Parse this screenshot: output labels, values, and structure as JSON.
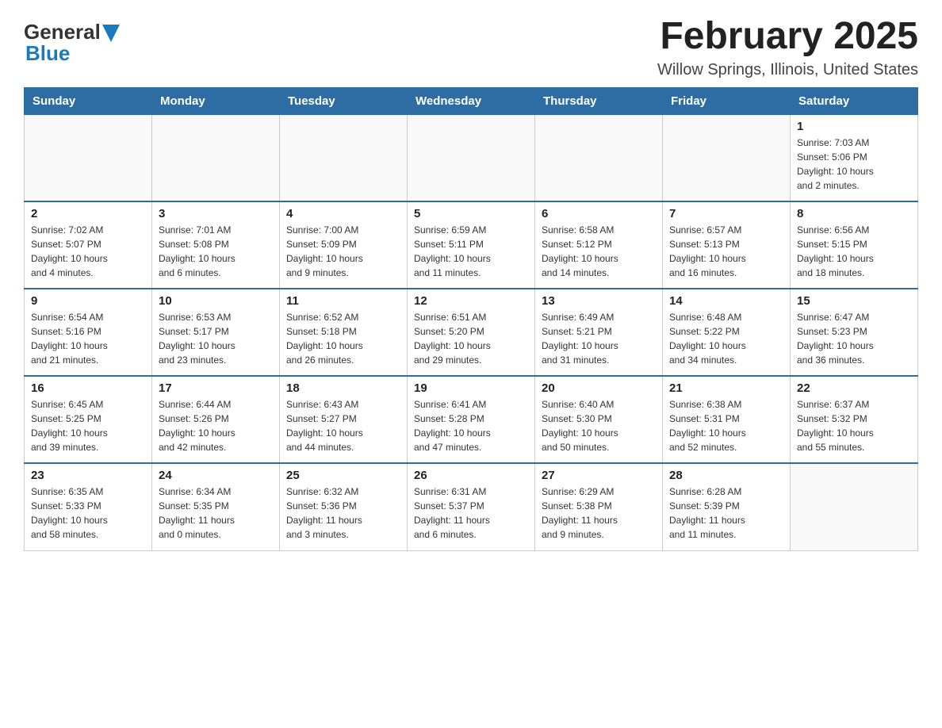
{
  "header": {
    "logo_general": "General",
    "logo_blue": "Blue",
    "month_title": "February 2025",
    "location": "Willow Springs, Illinois, United States"
  },
  "days_of_week": [
    "Sunday",
    "Monday",
    "Tuesday",
    "Wednesday",
    "Thursday",
    "Friday",
    "Saturday"
  ],
  "weeks": [
    [
      {
        "day": "",
        "info": ""
      },
      {
        "day": "",
        "info": ""
      },
      {
        "day": "",
        "info": ""
      },
      {
        "day": "",
        "info": ""
      },
      {
        "day": "",
        "info": ""
      },
      {
        "day": "",
        "info": ""
      },
      {
        "day": "1",
        "info": "Sunrise: 7:03 AM\nSunset: 5:06 PM\nDaylight: 10 hours\nand 2 minutes."
      }
    ],
    [
      {
        "day": "2",
        "info": "Sunrise: 7:02 AM\nSunset: 5:07 PM\nDaylight: 10 hours\nand 4 minutes."
      },
      {
        "day": "3",
        "info": "Sunrise: 7:01 AM\nSunset: 5:08 PM\nDaylight: 10 hours\nand 6 minutes."
      },
      {
        "day": "4",
        "info": "Sunrise: 7:00 AM\nSunset: 5:09 PM\nDaylight: 10 hours\nand 9 minutes."
      },
      {
        "day": "5",
        "info": "Sunrise: 6:59 AM\nSunset: 5:11 PM\nDaylight: 10 hours\nand 11 minutes."
      },
      {
        "day": "6",
        "info": "Sunrise: 6:58 AM\nSunset: 5:12 PM\nDaylight: 10 hours\nand 14 minutes."
      },
      {
        "day": "7",
        "info": "Sunrise: 6:57 AM\nSunset: 5:13 PM\nDaylight: 10 hours\nand 16 minutes."
      },
      {
        "day": "8",
        "info": "Sunrise: 6:56 AM\nSunset: 5:15 PM\nDaylight: 10 hours\nand 18 minutes."
      }
    ],
    [
      {
        "day": "9",
        "info": "Sunrise: 6:54 AM\nSunset: 5:16 PM\nDaylight: 10 hours\nand 21 minutes."
      },
      {
        "day": "10",
        "info": "Sunrise: 6:53 AM\nSunset: 5:17 PM\nDaylight: 10 hours\nand 23 minutes."
      },
      {
        "day": "11",
        "info": "Sunrise: 6:52 AM\nSunset: 5:18 PM\nDaylight: 10 hours\nand 26 minutes."
      },
      {
        "day": "12",
        "info": "Sunrise: 6:51 AM\nSunset: 5:20 PM\nDaylight: 10 hours\nand 29 minutes."
      },
      {
        "day": "13",
        "info": "Sunrise: 6:49 AM\nSunset: 5:21 PM\nDaylight: 10 hours\nand 31 minutes."
      },
      {
        "day": "14",
        "info": "Sunrise: 6:48 AM\nSunset: 5:22 PM\nDaylight: 10 hours\nand 34 minutes."
      },
      {
        "day": "15",
        "info": "Sunrise: 6:47 AM\nSunset: 5:23 PM\nDaylight: 10 hours\nand 36 minutes."
      }
    ],
    [
      {
        "day": "16",
        "info": "Sunrise: 6:45 AM\nSunset: 5:25 PM\nDaylight: 10 hours\nand 39 minutes."
      },
      {
        "day": "17",
        "info": "Sunrise: 6:44 AM\nSunset: 5:26 PM\nDaylight: 10 hours\nand 42 minutes."
      },
      {
        "day": "18",
        "info": "Sunrise: 6:43 AM\nSunset: 5:27 PM\nDaylight: 10 hours\nand 44 minutes."
      },
      {
        "day": "19",
        "info": "Sunrise: 6:41 AM\nSunset: 5:28 PM\nDaylight: 10 hours\nand 47 minutes."
      },
      {
        "day": "20",
        "info": "Sunrise: 6:40 AM\nSunset: 5:30 PM\nDaylight: 10 hours\nand 50 minutes."
      },
      {
        "day": "21",
        "info": "Sunrise: 6:38 AM\nSunset: 5:31 PM\nDaylight: 10 hours\nand 52 minutes."
      },
      {
        "day": "22",
        "info": "Sunrise: 6:37 AM\nSunset: 5:32 PM\nDaylight: 10 hours\nand 55 minutes."
      }
    ],
    [
      {
        "day": "23",
        "info": "Sunrise: 6:35 AM\nSunset: 5:33 PM\nDaylight: 10 hours\nand 58 minutes."
      },
      {
        "day": "24",
        "info": "Sunrise: 6:34 AM\nSunset: 5:35 PM\nDaylight: 11 hours\nand 0 minutes."
      },
      {
        "day": "25",
        "info": "Sunrise: 6:32 AM\nSunset: 5:36 PM\nDaylight: 11 hours\nand 3 minutes."
      },
      {
        "day": "26",
        "info": "Sunrise: 6:31 AM\nSunset: 5:37 PM\nDaylight: 11 hours\nand 6 minutes."
      },
      {
        "day": "27",
        "info": "Sunrise: 6:29 AM\nSunset: 5:38 PM\nDaylight: 11 hours\nand 9 minutes."
      },
      {
        "day": "28",
        "info": "Sunrise: 6:28 AM\nSunset: 5:39 PM\nDaylight: 11 hours\nand 11 minutes."
      },
      {
        "day": "",
        "info": ""
      }
    ]
  ]
}
